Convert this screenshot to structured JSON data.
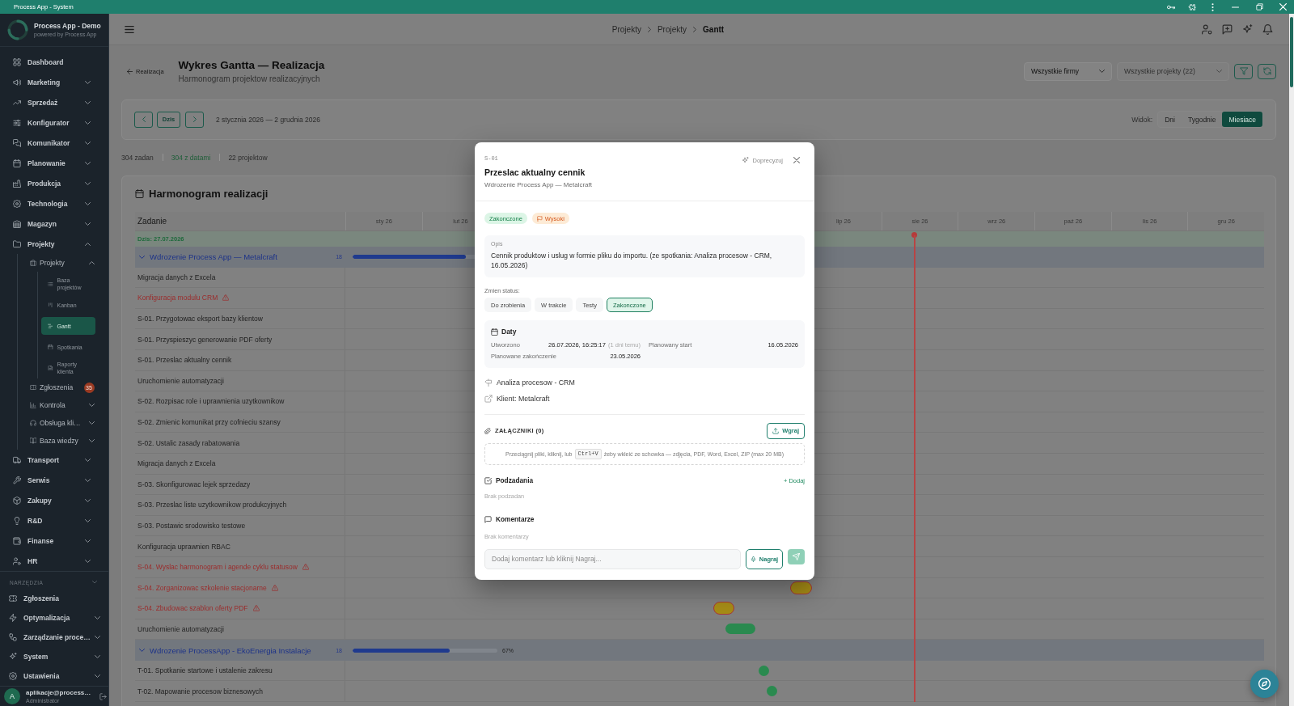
{
  "window": {
    "title": "Process App - System"
  },
  "sidebar": {
    "brand": {
      "name": "Process App - Demo",
      "tagline": "powered by Process App"
    },
    "items": [
      {
        "label": "Dashboard",
        "kind": "link",
        "selected": false
      },
      {
        "label": "Marketing",
        "kind": "group",
        "expanded": false,
        "selected": false
      },
      {
        "label": "Sprzedaż",
        "kind": "group",
        "expanded": false,
        "selected": false
      },
      {
        "label": "Konfigurator",
        "kind": "group",
        "expanded": false,
        "selected": false
      },
      {
        "label": "Komunikator",
        "kind": "group",
        "expanded": false,
        "selected": false
      },
      {
        "label": "Planowanie",
        "kind": "group",
        "expanded": false,
        "selected": false
      },
      {
        "label": "Produkcja",
        "kind": "group",
        "expanded": false,
        "selected": false
      },
      {
        "label": "Technologia",
        "kind": "group",
        "expanded": false,
        "selected": false
      },
      {
        "label": "Magazyn",
        "kind": "group",
        "expanded": false,
        "selected": false
      },
      {
        "label": "Projekty",
        "kind": "group",
        "expanded": true,
        "selected": false,
        "children": [
          {
            "label": "Projekty",
            "kind": "group",
            "expanded": true,
            "selected": false,
            "children": [
              {
                "label": "Baza projektów",
                "kind": "link",
                "selected": false
              },
              {
                "label": "Kanban",
                "kind": "link",
                "selected": false
              },
              {
                "label": "Gantt",
                "kind": "link",
                "selected": true
              },
              {
                "label": "Spotkania",
                "kind": "link",
                "selected": false
              },
              {
                "label": "Raporty klienta",
                "kind": "link",
                "selected": false
              }
            ]
          },
          {
            "label": "Zgłoszenia",
            "kind": "link",
            "selected": false,
            "badge": "35"
          },
          {
            "label": "Kontrola",
            "kind": "group",
            "expanded": false,
            "selected": false
          },
          {
            "label": "Obsługa kli…",
            "kind": "group",
            "expanded": false,
            "selected": false
          },
          {
            "label": "Baza wiedzy",
            "kind": "group",
            "expanded": false,
            "selected": false
          }
        ]
      },
      {
        "label": "Transport",
        "kind": "group",
        "expanded": false,
        "selected": false
      },
      {
        "label": "Serwis",
        "kind": "group",
        "expanded": false,
        "selected": false
      },
      {
        "label": "Zakupy",
        "kind": "group",
        "expanded": false,
        "selected": false
      },
      {
        "label": "R&D",
        "kind": "group",
        "expanded": false,
        "selected": false
      },
      {
        "label": "Finanse",
        "kind": "group",
        "expanded": false,
        "selected": false
      },
      {
        "label": "HR",
        "kind": "group",
        "expanded": false,
        "selected": false
      }
    ],
    "tools": {
      "title": "NARZĘDZIA",
      "items": [
        {
          "label": "Zgłoszenia",
          "kind": "link",
          "selected": false
        },
        {
          "label": "Optymalizacja",
          "kind": "group",
          "expanded": false,
          "selected": false
        },
        {
          "label": "Zarządzanie proce…",
          "kind": "group",
          "expanded": false,
          "selected": false
        },
        {
          "label": "System",
          "kind": "group",
          "expanded": false,
          "selected": false
        },
        {
          "label": "Ustawienia",
          "kind": "group",
          "expanded": false,
          "selected": false
        }
      ]
    },
    "user": {
      "initial": "A",
      "name": "aplikacje@process…",
      "role": "Administrator"
    }
  },
  "topbar": {
    "breadcrumb": [
      {
        "label": "Projekty",
        "current": false
      },
      {
        "label": "Projekty",
        "current": false
      },
      {
        "label": "Gantt",
        "current": true
      }
    ]
  },
  "page": {
    "back_link": "Realizacja",
    "title": "Wykres Gantta — Realizacja",
    "subtitle": "Harmonogram projektow realizacyjnych",
    "filters": [
      {
        "value": "Wszystkie firmy",
        "disabled": false
      },
      {
        "value": "Wszystkie projekty (22)",
        "disabled": true
      }
    ],
    "toolbar": {
      "today_button": "Dzis",
      "range": "2 stycznia 2026 — 2 grudnia 2026",
      "view_label": "Widok:",
      "views": [
        {
          "label": "Dni",
          "selected": false
        },
        {
          "label": "Tygodnie",
          "selected": false
        },
        {
          "label": "Miesiace",
          "selected": true
        }
      ]
    },
    "stats": [
      {
        "text": "304 zadan",
        "highlight": false
      },
      {
        "text": "304 z datami",
        "highlight": true
      },
      {
        "text": "22 projektow",
        "highlight": false
      }
    ],
    "gantt": {
      "title": "Harmonogram realizacji",
      "task_header": "Zadanie",
      "months_start": [
        "sty 26",
        "lut 26"
      ],
      "months_end": [
        "lip 26",
        "sie 26",
        "wrz 26",
        "paź 26",
        "lis 26",
        "gru 26"
      ],
      "today": "Dzis: 27.07.2026",
      "groups": [
        {
          "title": "Wdrozenie Process App — Metalcraft",
          "count": "18",
          "expanded": true,
          "level": 0.78,
          "tasks": [
            {
              "name": "Migracja danych z Excela",
              "overdue": false
            },
            {
              "name": "Konfiguracja modulu CRM",
              "overdue": true
            },
            {
              "name": "S-01. Przygotowac eksport bazy klientow",
              "overdue": false
            },
            {
              "name": "S-01. Przyspieszyc generowanie PDF oferty",
              "overdue": false
            },
            {
              "name": "S-01. Przeslac aktualny cennik",
              "overdue": false
            },
            {
              "name": "Uruchomienie automatyzacji",
              "overdue": false
            },
            {
              "name": "S-02. Rozpisac role i uprawnienia uzytkownikow",
              "overdue": false
            },
            {
              "name": "S-02. Zmienic komunikat przy cofnieciu szansy",
              "overdue": false
            },
            {
              "name": "S-02. Ustalic zasady rabatowania",
              "overdue": false
            },
            {
              "name": "Migracja danych z Excela",
              "overdue": false
            },
            {
              "name": "S-03. Skonfigurowac lejek sprzedazy",
              "overdue": false
            },
            {
              "name": "S-03. Przeslac liste uzytkownikow produkcyjnych",
              "overdue": false
            },
            {
              "name": "S-03. Postawic srodowisko testowe",
              "overdue": false
            },
            {
              "name": "Konfiguracja uprawnien RBAC",
              "overdue": false
            },
            {
              "name": "S-04. Wyslac harmonogram i agende cyklu statusow",
              "overdue": true
            },
            {
              "name": "S-04. Zorganizowac szkolenie stacjonarne",
              "overdue": true,
              "bar": {
                "kind": "in_progress"
              }
            },
            {
              "name": "S-04. Zbudowac szablon oferty PDF",
              "overdue": true,
              "bar": {
                "kind": "in_progress"
              }
            },
            {
              "name": "Uruchomienie automatyzacji",
              "overdue": false,
              "bar": {
                "kind": "done"
              }
            }
          ]
        },
        {
          "title": "Wdrozenie ProcessApp - EkoEnergia Instalacje",
          "count": "18",
          "expanded": true,
          "level": 0.67,
          "progress_label": "67%",
          "tasks": [
            {
              "name": "T-01. Spotkanie startowe i ustalenie zakresu",
              "overdue": false,
              "bar": {
                "kind": "done"
              }
            },
            {
              "name": "T-02. Mapowanie procesow biznesowych",
              "overdue": false,
              "bar": {
                "kind": "done"
              }
            }
          ]
        }
      ]
    }
  },
  "task_dialog": {
    "code": "S-01",
    "title": "Przeslac aktualny cennik",
    "project": "Wdrozenie Process App — Metalcraft",
    "refine_button": "Doprecyzuj",
    "badges": [
      {
        "kind": "status",
        "text": "Zakonczone"
      },
      {
        "kind": "priority",
        "text": "Wysoki"
      }
    ],
    "description": {
      "label": "Opis",
      "text": "Cennik produktow i uslug w formie pliku do importu. (ze spotkania: Analiza procesow - CRM, 16.05.2026)"
    },
    "status_label": "Zmien status:",
    "statuses": [
      {
        "label": "Do zrobienia",
        "selected": false
      },
      {
        "label": "W trakcie",
        "selected": false
      },
      {
        "label": "Testy",
        "selected": false
      },
      {
        "label": "Zakonczone",
        "selected": true
      }
    ],
    "dates": {
      "title": "Daty",
      "fields": [
        {
          "label": "Utworzono",
          "value": "26.07.2026, 16:25:17",
          "note": "(1 dni temu)"
        },
        {
          "label": "Planowany start",
          "value": "16.05.2026"
        },
        {
          "label": "Planowane zakończenie",
          "value": "23.05.2026"
        }
      ]
    },
    "links": [
      {
        "kind": "meeting",
        "text": "Analiza procesow - CRM"
      },
      {
        "kind": "client",
        "text": "Klient: Metalcraft"
      }
    ],
    "attachments": {
      "title": "ZAŁĄCZNIKI (0)",
      "upload_button": "Wgraj",
      "hint_before": "Przeciągnij pliki, kliknij, lub",
      "shortcut": "Ctrl+V",
      "hint_after": "żeby wkleić ze schowka — zdjęcia, PDF, Word, Excel, ZIP (max 20 MB)"
    },
    "subtasks": {
      "title": "Podzadania",
      "add_link": "+ Dodaj",
      "empty": "Brak podzadan"
    },
    "comments": {
      "title": "Komentarze",
      "empty": "Brak komentarzy",
      "placeholder": "Dodaj komentarz lub kliknij Nagraj...",
      "record_button": "Nagraj"
    }
  }
}
